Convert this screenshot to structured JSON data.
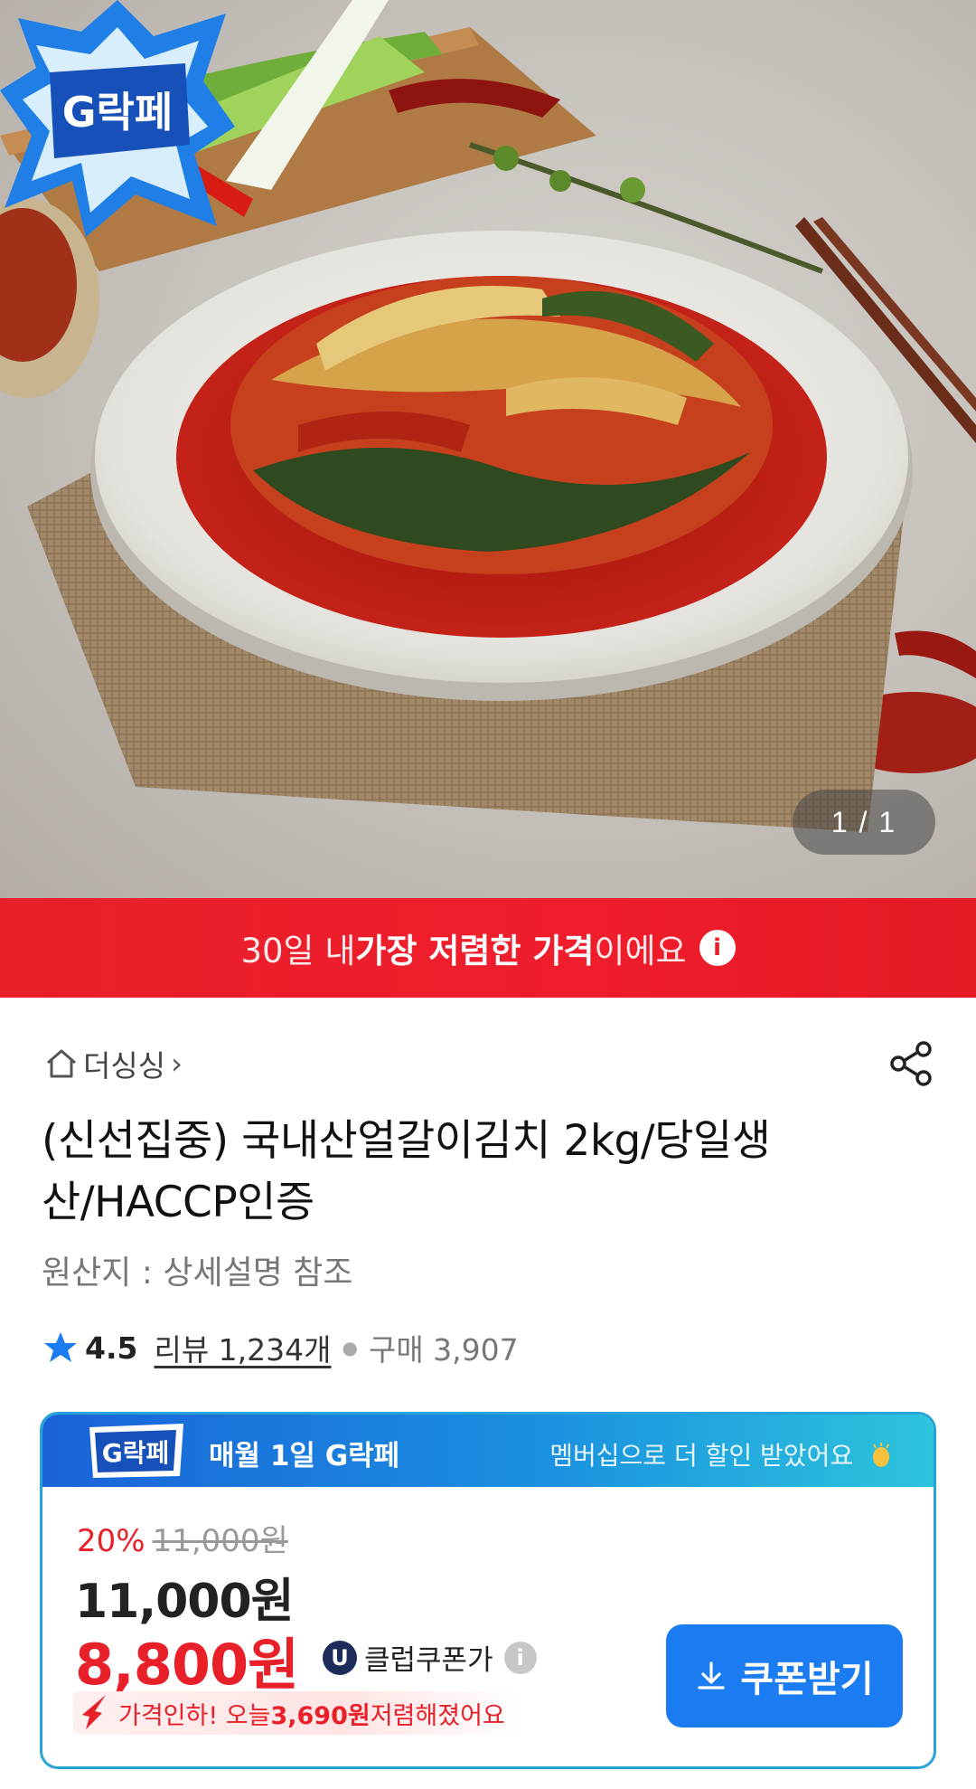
{
  "hero": {
    "badge_text": "G락페",
    "page_counter": "1 / 1"
  },
  "banner": {
    "prefix": "30일 내 ",
    "highlight": "가장 저렴한 가격",
    "suffix": "이에요",
    "info_icon": "i"
  },
  "store": {
    "name": "더싱싱",
    "chevron": "›"
  },
  "product": {
    "title": "(신선집중) 국내산얼갈이김치 2kg/당일생산/HACCP인증",
    "origin": "원산지 : 상세설명 참조",
    "rating": "4.5",
    "reviews": "리뷰 1,234개",
    "purchase": "구매 3,907"
  },
  "promo_card": {
    "logo_text": "G락페",
    "promo_title": "매월 1일 G락페",
    "member_text": "멤버십으로 더 할인 받았어요",
    "discount_pct": "20%",
    "original_price": "11,000원",
    "sale_price": "11,000원",
    "coupon_price": "8,800원",
    "club_badge": "U",
    "club_label": "클럽쿠폰가",
    "club_info": "i",
    "drop_prefix": "가격인하! 오늘 ",
    "drop_amount": "3,690원",
    "drop_suffix": " 저렴해졌어요",
    "coupon_button": "쿠폰받기"
  },
  "colors": {
    "banner_red": "#e8202a",
    "price_red": "#e8202a",
    "coupon_blue": "#1a7cf0",
    "header_gradient_start": "#1a63d8",
    "header_gradient_end": "#2dc4dc"
  },
  "icons": [
    "home-icon",
    "share-icon",
    "star-icon",
    "info-icon",
    "download-icon",
    "price-drop-arrow-icon",
    "clap-icon"
  ]
}
